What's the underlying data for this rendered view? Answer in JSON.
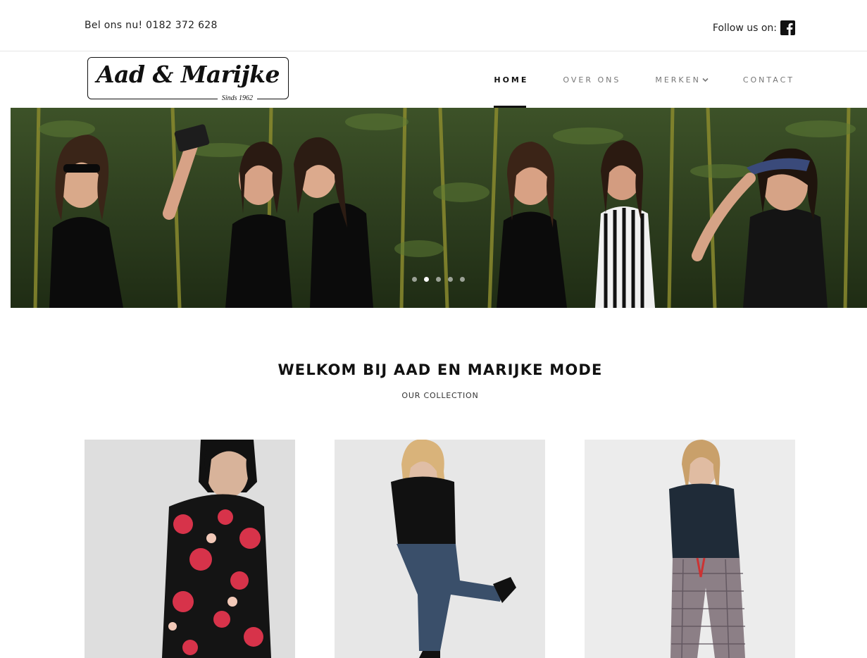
{
  "topbar": {
    "phone_text": "Bel ons nu! 0182 372 628",
    "follow_label": "Follow us on:",
    "social_icon": "facebook-icon"
  },
  "header": {
    "logo_main": "Aad & Marijke",
    "logo_sub": "Sinds 1962"
  },
  "nav": {
    "items": [
      {
        "label": "HOME",
        "active": true
      },
      {
        "label": "OVER ONS",
        "active": false
      },
      {
        "label": "MERKEN",
        "active": false,
        "icon": "chevron-down-icon"
      },
      {
        "label": "CONTACT",
        "active": false
      }
    ]
  },
  "hero": {
    "slide_count": 5,
    "active_slide": 2
  },
  "welcome": {
    "title": "WELKOM BIJ AAD EN MARIJKE MODE",
    "subtitle": "OUR COLLECTION"
  },
  "colors": {
    "text": "#111111",
    "nav_inactive": "#777777",
    "foliage": "#2d3f1f"
  }
}
